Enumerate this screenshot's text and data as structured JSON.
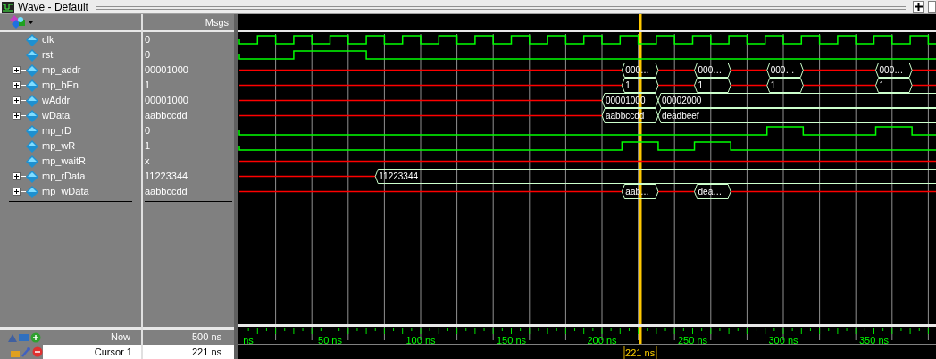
{
  "window": {
    "title": "Wave - Default"
  },
  "header": {
    "values_heading": "Msgs"
  },
  "signals": [
    {
      "name": "clk",
      "value": "0",
      "kind": "clock",
      "expandable": false
    },
    {
      "name": "rst",
      "value": "0",
      "kind": "bit",
      "expandable": false
    },
    {
      "name": "mp_addr",
      "value": "00001000",
      "kind": "bus",
      "expandable": true,
      "segments": [
        "000…",
        "000…",
        "000…",
        "000…"
      ]
    },
    {
      "name": "mp_bEn",
      "value": "1",
      "kind": "bus",
      "expandable": true,
      "segments": [
        "1",
        "1",
        "1",
        "1"
      ]
    },
    {
      "name": "wAddr",
      "value": "00001000",
      "kind": "bus",
      "expandable": true,
      "segments": [
        "00001000",
        "00002000"
      ]
    },
    {
      "name": "wData",
      "value": "aabbccdd",
      "kind": "bus",
      "expandable": true,
      "segments": [
        "aabbccdd",
        "deadbeef"
      ]
    },
    {
      "name": "mp_rD",
      "value": "0",
      "kind": "bit",
      "expandable": false
    },
    {
      "name": "mp_wR",
      "value": "1",
      "kind": "bit",
      "expandable": false
    },
    {
      "name": "mp_waitR",
      "value": "x",
      "kind": "unknown",
      "expandable": false
    },
    {
      "name": "mp_rData",
      "value": "11223344",
      "kind": "bus",
      "expandable": true,
      "segments": [
        "11223344"
      ]
    },
    {
      "name": "mp_wData",
      "value": "aabbccdd",
      "kind": "bus",
      "expandable": true,
      "segments": [
        "aab…",
        "dea…"
      ]
    }
  ],
  "ruler_labels": [
    "ns",
    "50 ns",
    "100 ns",
    "150 ns",
    "200 ns",
    "250 ns",
    "300 ns",
    "350 ns"
  ],
  "now": {
    "label": "Now",
    "time": "500 ns"
  },
  "cursor": {
    "label": "Cursor 1",
    "time": "221 ns",
    "marker": "221 ns"
  }
}
